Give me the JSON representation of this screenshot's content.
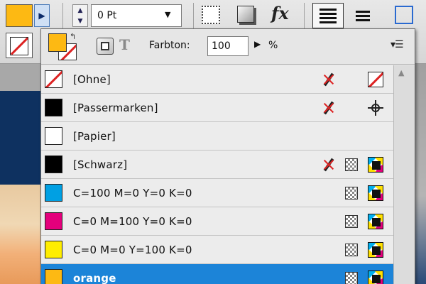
{
  "control_bar": {
    "stroke_weight": "0 Pt",
    "colors": {
      "fill": "#fdb913",
      "accent": "#1c84d8"
    }
  },
  "swatches_panel": {
    "tint_label": "Farbton:",
    "tint_value": "100",
    "tint_unit": "%",
    "swatches": [
      {
        "name": "[Ohne]",
        "color": "none",
        "icons": [
          "no-edit-icon",
          "none-type-icon"
        ]
      },
      {
        "name": "[Passermarken]",
        "color": "#000000",
        "icons": [
          "no-edit-icon",
          "registration-icon"
        ]
      },
      {
        "name": "[Papier]",
        "color": "#ffffff",
        "icons": []
      },
      {
        "name": "[Schwarz]",
        "color": "#000000",
        "icons": [
          "no-edit-icon",
          "process-icon",
          "cmyk-icon"
        ]
      },
      {
        "name": "C=100 M=0 Y=0 K=0",
        "color": "#00a0e3",
        "icons": [
          "process-icon",
          "cmyk-icon"
        ]
      },
      {
        "name": "C=0 M=100 Y=0 K=0",
        "color": "#e4007c",
        "icons": [
          "process-icon",
          "cmyk-icon"
        ]
      },
      {
        "name": "C=0 M=0 Y=100 K=0",
        "color": "#ffed00",
        "icons": [
          "process-icon",
          "cmyk-icon"
        ]
      },
      {
        "name": "orange",
        "color": "#fdb913",
        "selected": true,
        "icons": [
          "process-icon",
          "cmyk-icon"
        ]
      }
    ]
  }
}
